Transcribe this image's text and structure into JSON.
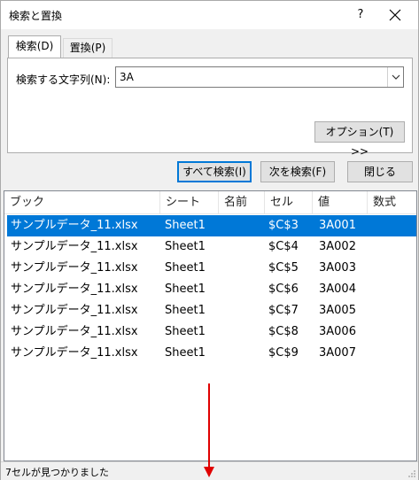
{
  "dialog": {
    "title": "検索と置換",
    "help_glyph": "?",
    "close_glyph": "×"
  },
  "tabs": [
    {
      "label": "検索(D)",
      "active": true
    },
    {
      "label": "置換(P)",
      "active": false
    }
  ],
  "find": {
    "label": "検索する文字列(N):",
    "value": "3A"
  },
  "buttons": {
    "options": "オプション(T) >>",
    "find_all": "すべて検索(I)",
    "find_next": "次を検索(F)",
    "close": "閉じる"
  },
  "results": {
    "columns": [
      "ブック",
      "シート",
      "名前",
      "セル",
      "値",
      "数式"
    ],
    "rows": [
      {
        "book": "サンプルデータ_11.xlsx",
        "sheet": "Sheet1",
        "name": "",
        "cell": "$C$3",
        "value": "3A001",
        "formula": "",
        "selected": true
      },
      {
        "book": "サンプルデータ_11.xlsx",
        "sheet": "Sheet1",
        "name": "",
        "cell": "$C$4",
        "value": "3A002",
        "formula": "",
        "selected": false
      },
      {
        "book": "サンプルデータ_11.xlsx",
        "sheet": "Sheet1",
        "name": "",
        "cell": "$C$5",
        "value": "3A003",
        "formula": "",
        "selected": false
      },
      {
        "book": "サンプルデータ_11.xlsx",
        "sheet": "Sheet1",
        "name": "",
        "cell": "$C$6",
        "value": "3A004",
        "formula": "",
        "selected": false
      },
      {
        "book": "サンプルデータ_11.xlsx",
        "sheet": "Sheet1",
        "name": "",
        "cell": "$C$7",
        "value": "3A005",
        "formula": "",
        "selected": false
      },
      {
        "book": "サンプルデータ_11.xlsx",
        "sheet": "Sheet1",
        "name": "",
        "cell": "$C$8",
        "value": "3A006",
        "formula": "",
        "selected": false
      },
      {
        "book": "サンプルデータ_11.xlsx",
        "sheet": "Sheet1",
        "name": "",
        "cell": "$C$9",
        "value": "3A007",
        "formula": "",
        "selected": false
      }
    ]
  },
  "status": {
    "text": "7セルが見つかりました"
  },
  "colors": {
    "selection": "#0078d7",
    "annotation_arrow": "#e00000"
  }
}
